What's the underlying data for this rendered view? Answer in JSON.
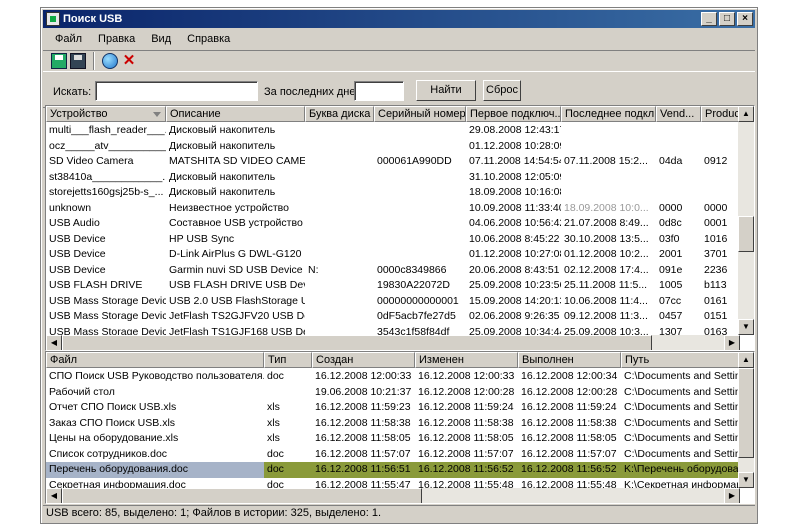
{
  "window": {
    "title": "Поиск USB"
  },
  "menu": [
    "Файл",
    "Правка",
    "Вид",
    "Справка"
  ],
  "toolbar": {
    "icons": [
      "save-green-icon",
      "save-icon",
      "globe-icon",
      "delete-icon"
    ]
  },
  "search": {
    "label": "Искать:",
    "value": "",
    "days_label": "За последних дней:",
    "days_value": "",
    "find_button": "Найти",
    "reset_button": "Сброс"
  },
  "devices": {
    "columns": [
      "Устройство",
      "Описание",
      "Буква диска",
      "Серийный номер",
      "Первое подключ...",
      "Последнее подкл...",
      "Vend...",
      "Product..."
    ],
    "rows": [
      [
        "multi___flash_reader___...",
        "Дисковый накопитель",
        "",
        "",
        "29.08.2008 12:43:17",
        "",
        "",
        ""
      ],
      [
        "ocz_____atv___________...",
        "Дисковый накопитель",
        "",
        "",
        "01.12.2008 10:28:09",
        "",
        "",
        ""
      ],
      [
        "SD Video Camera",
        "MATSHITA SD VIDEO CAMER...",
        "",
        "000061A990DD",
        "07.11.2008 14:54:54",
        "07.11.2008 15:2...",
        "04da",
        "0912"
      ],
      [
        "st38410a____________...",
        "Дисковый накопитель",
        "",
        "",
        "31.10.2008 12:05:09",
        "",
        "",
        ""
      ],
      [
        "storejetts160gsj25b-s_...",
        "Дисковый накопитель",
        "",
        "",
        "18.09.2008 10:16:08",
        "",
        "",
        ""
      ],
      [
        "unknown",
        "Неизвестное устройство",
        "",
        "",
        "10.09.2008 11:33:40",
        "18.09.2008 10:0...",
        "0000",
        "0000"
      ],
      [
        "USB Audio",
        "Составное USB устройство",
        "",
        "",
        "04.06.2008 10:56:42",
        "21.07.2008 8:49...",
        "0d8c",
        "0001"
      ],
      [
        "USB Device",
        "HP USB Sync",
        "",
        "",
        "10.06.2008 8:45:22",
        "30.10.2008 13:5...",
        "03f0",
        "1016"
      ],
      [
        "USB Device",
        "D-Link AirPlus G DWL-G120 ...",
        "",
        "",
        "01.12.2008 10:27:08",
        "01.12.2008 10:2...",
        "2001",
        "3701"
      ],
      [
        "USB Device",
        "Garmin nuvi SD USB Device",
        "N:",
        "0000c8349866",
        "20.06.2008 8:43:51",
        "02.12.2008 17:4...",
        "091e",
        "2236"
      ],
      [
        "USB FLASH DRIVE",
        "USB FLASH DRIVE USB Device",
        "",
        "19830A22072D",
        "25.09.2008 10:23:56",
        "25.11.2008 11:5...",
        "1005",
        "b113"
      ],
      [
        "USB Mass Storage Device",
        "USB 2.0 USB FlashStorage U...",
        "",
        "00000000000001",
        "15.09.2008 14:20:13",
        "10.06.2008 11:4...",
        "07cc",
        "0161"
      ],
      [
        "USB Mass Storage Device",
        "JetFlash TS2GJFV20 USB De...",
        "",
        "0dF5acb7fe27d5",
        "02.06.2008 9:26:35",
        "09.12.2008 11:3...",
        "0457",
        "0151"
      ],
      [
        "USB Mass Storage Device",
        "JetFlash TS1GJF168 USB De...",
        "",
        "3543c1f58f84df",
        "25.09.2008 10:34:44",
        "25.09.2008 10:3...",
        "1307",
        "0163"
      ]
    ]
  },
  "files": {
    "columns": [
      "Файл",
      "Тип",
      "Создан",
      "Изменен",
      "Выполнен",
      "Путь"
    ],
    "rows": [
      [
        "СПО Поиск USB Руководство пользователя.doc",
        "doc",
        "16.12.2008 12:00:33",
        "16.12.2008 12:00:33",
        "16.12.2008 12:00:34",
        "C:\\Documents and Settings\\"
      ],
      [
        "Рабочий стол",
        "",
        "19.06.2008 10:21:37",
        "16.12.2008 12:00:28",
        "16.12.2008 12:00:28",
        "C:\\Documents and Settings\\"
      ],
      [
        "Отчет СПО Поиск USB.xls",
        "xls",
        "16.12.2008 11:59:23",
        "16.12.2008 11:59:24",
        "16.12.2008 11:59:24",
        "C:\\Documents and Settings\\"
      ],
      [
        "Заказ СПО Поиск USB.xls",
        "xls",
        "16.12.2008 11:58:38",
        "16.12.2008 11:58:38",
        "16.12.2008 11:58:38",
        "C:\\Documents and Settings\\"
      ],
      [
        "Цены на оборудование.xls",
        "xls",
        "16.12.2008 11:58:05",
        "16.12.2008 11:58:05",
        "16.12.2008 11:58:05",
        "C:\\Documents and Settings\\"
      ],
      [
        "Список сотрудников.doc",
        "doc",
        "16.12.2008 11:57:07",
        "16.12.2008 11:57:07",
        "16.12.2008 11:57:07",
        "C:\\Documents and Settings\\"
      ],
      [
        "Перечень оборудования.doc",
        "doc",
        "16.12.2008 11:56:51",
        "16.12.2008 11:56:52",
        "16.12.2008 11:56:52",
        "K:\\Перечень оборудования"
      ],
      [
        "Секретная информация.doc",
        "doc",
        "16.12.2008 11:55:47",
        "16.12.2008 11:55:48",
        "16.12.2008 11:55:48",
        "K:\\Секретная информац..."
      ]
    ]
  },
  "status": "USB всего: 85,  выделено: 1;    Файлов в истории: 325,  выделено: 1."
}
